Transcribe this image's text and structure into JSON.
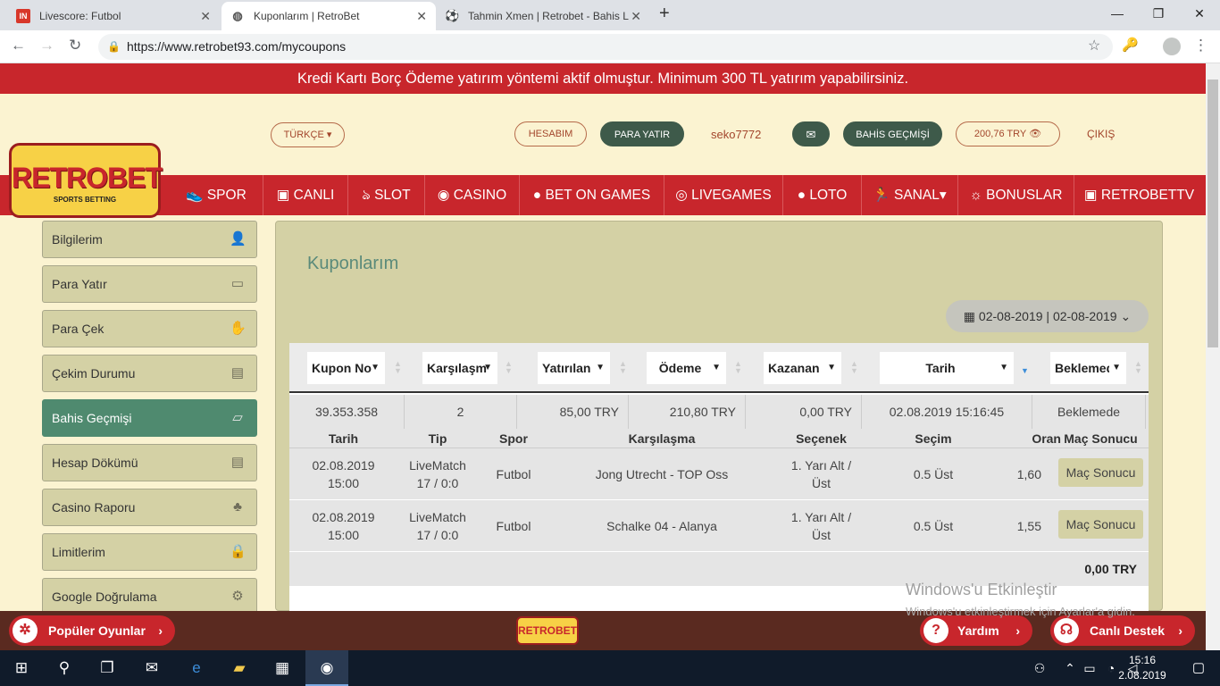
{
  "browser": {
    "tabs": [
      {
        "title": "Livescore: Futbol",
        "favicon": "IN"
      },
      {
        "title": "Kuponlarım | RetroBet",
        "favicon": "globe"
      },
      {
        "title": "Tahmin Xmen | Retrobet - Bahis L",
        "favicon": "ball"
      }
    ],
    "url": "https://www.retrobet93.com/mycoupons"
  },
  "banner": "Kredi Kartı Borç Ödeme yatırım yöntemi aktif olmuştur. Minimum 300 TL yatırım yapabilirsiniz.",
  "header": {
    "language": "TÜRKÇE",
    "account": "HESABIM",
    "deposit": "PARA YATIR",
    "username": "seko7772",
    "bet_history": "BAHİS GEÇMİŞİ",
    "balance": "200,76 TRY",
    "logout": "ÇIKIŞ"
  },
  "logo": {
    "name": "RETROBET",
    "tagline": "SPORTS BETTING"
  },
  "nav": [
    "SPOR",
    "CANLI",
    "SLOT",
    "CASINO",
    "BET ON GAMES",
    "LIVEGAMES",
    "LOTO",
    "SANAL",
    "BONUSLAR",
    "RETROBETTV"
  ],
  "sidebar": [
    {
      "label": "Bilgilerim",
      "icon": "user-icon"
    },
    {
      "label": "Para Yatır",
      "icon": "wallet-icon"
    },
    {
      "label": "Para Çek",
      "icon": "hand-coin-icon"
    },
    {
      "label": "Çekim Durumu",
      "icon": "money-icon"
    },
    {
      "label": "Bahis Geçmişi",
      "icon": "ticket-icon",
      "active": true
    },
    {
      "label": "Hesap Dökümü",
      "icon": "statement-icon"
    },
    {
      "label": "Casino Raporu",
      "icon": "cherries-icon"
    },
    {
      "label": "Limitlerim",
      "icon": "lock-icon"
    },
    {
      "label": "Google Doğrulama",
      "icon": "google-icon"
    }
  ],
  "main": {
    "title": "Kuponlarım",
    "date_range": "02-08-2019 | 02-08-2019",
    "filters": [
      "Kupon No",
      "Karşılaşm",
      "Yatırılan",
      "Ödeme",
      "Kazanan",
      "Tarih",
      "Beklemed"
    ],
    "summary": {
      "coupon_no": "39.353.358",
      "matches": "2",
      "stake": "85,00 TRY",
      "payout": "210,80 TRY",
      "won": "0,00 TRY",
      "date": "02.08.2019 15:16:45",
      "status": "Beklemede"
    },
    "detail_headers": [
      "Tarih",
      "Tip",
      "Spor",
      "Karşılaşma",
      "Seçenek",
      "Seçim",
      "Oran",
      "Maç Sonucu"
    ],
    "details": [
      {
        "date": "02.08.2019",
        "time": "15:00",
        "tip1": "LiveMatch",
        "tip2": "17 / 0:0",
        "sport": "Futbol",
        "match": "Jong Utrecht - TOP Oss",
        "option1": "1. Yarı Alt /",
        "option2": "Üst",
        "choice": "0.5 Üst",
        "odds": "1,60",
        "result": "Maç Sonucu"
      },
      {
        "date": "02.08.2019",
        "time": "15:00",
        "tip1": "LiveMatch",
        "tip2": "17 / 0:0",
        "sport": "Futbol",
        "match": "Schalke 04 - Alanya",
        "option1": "1. Yarı Alt /",
        "option2": "Üst",
        "choice": "0.5 Üst",
        "odds": "1,55",
        "result": "Maç Sonucu"
      }
    ],
    "total": "0,00 TRY"
  },
  "watermark": {
    "title": "Windows'u Etkinleştir",
    "subtitle": "Windows'u etkinleştirmek için Ayarlar'a gidin."
  },
  "bottom": {
    "popular": "Popüler Oyunlar",
    "help": "Yardım",
    "support": "Canlı Destek"
  },
  "taskbar": {
    "time": "15:16",
    "date": "2.08.2019"
  }
}
